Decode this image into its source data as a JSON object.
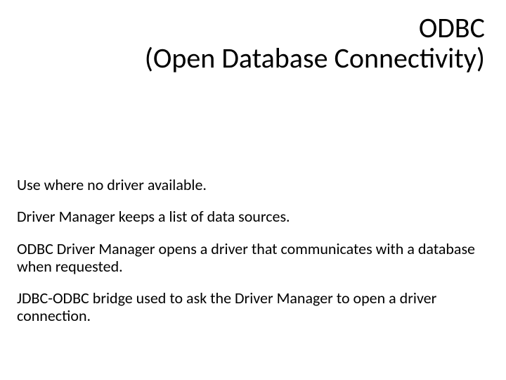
{
  "title": {
    "line1": "ODBC",
    "line2": "(Open Database Connectivity)"
  },
  "body": {
    "p1": "Use where no driver available.",
    "p2": "Driver Manager keeps a list of data sources.",
    "p3": "ODBC Driver Manager opens a driver that communicates with a database when requested.",
    "p4": "JDBC-ODBC bridge used to ask the Driver Manager to open a driver connection."
  }
}
